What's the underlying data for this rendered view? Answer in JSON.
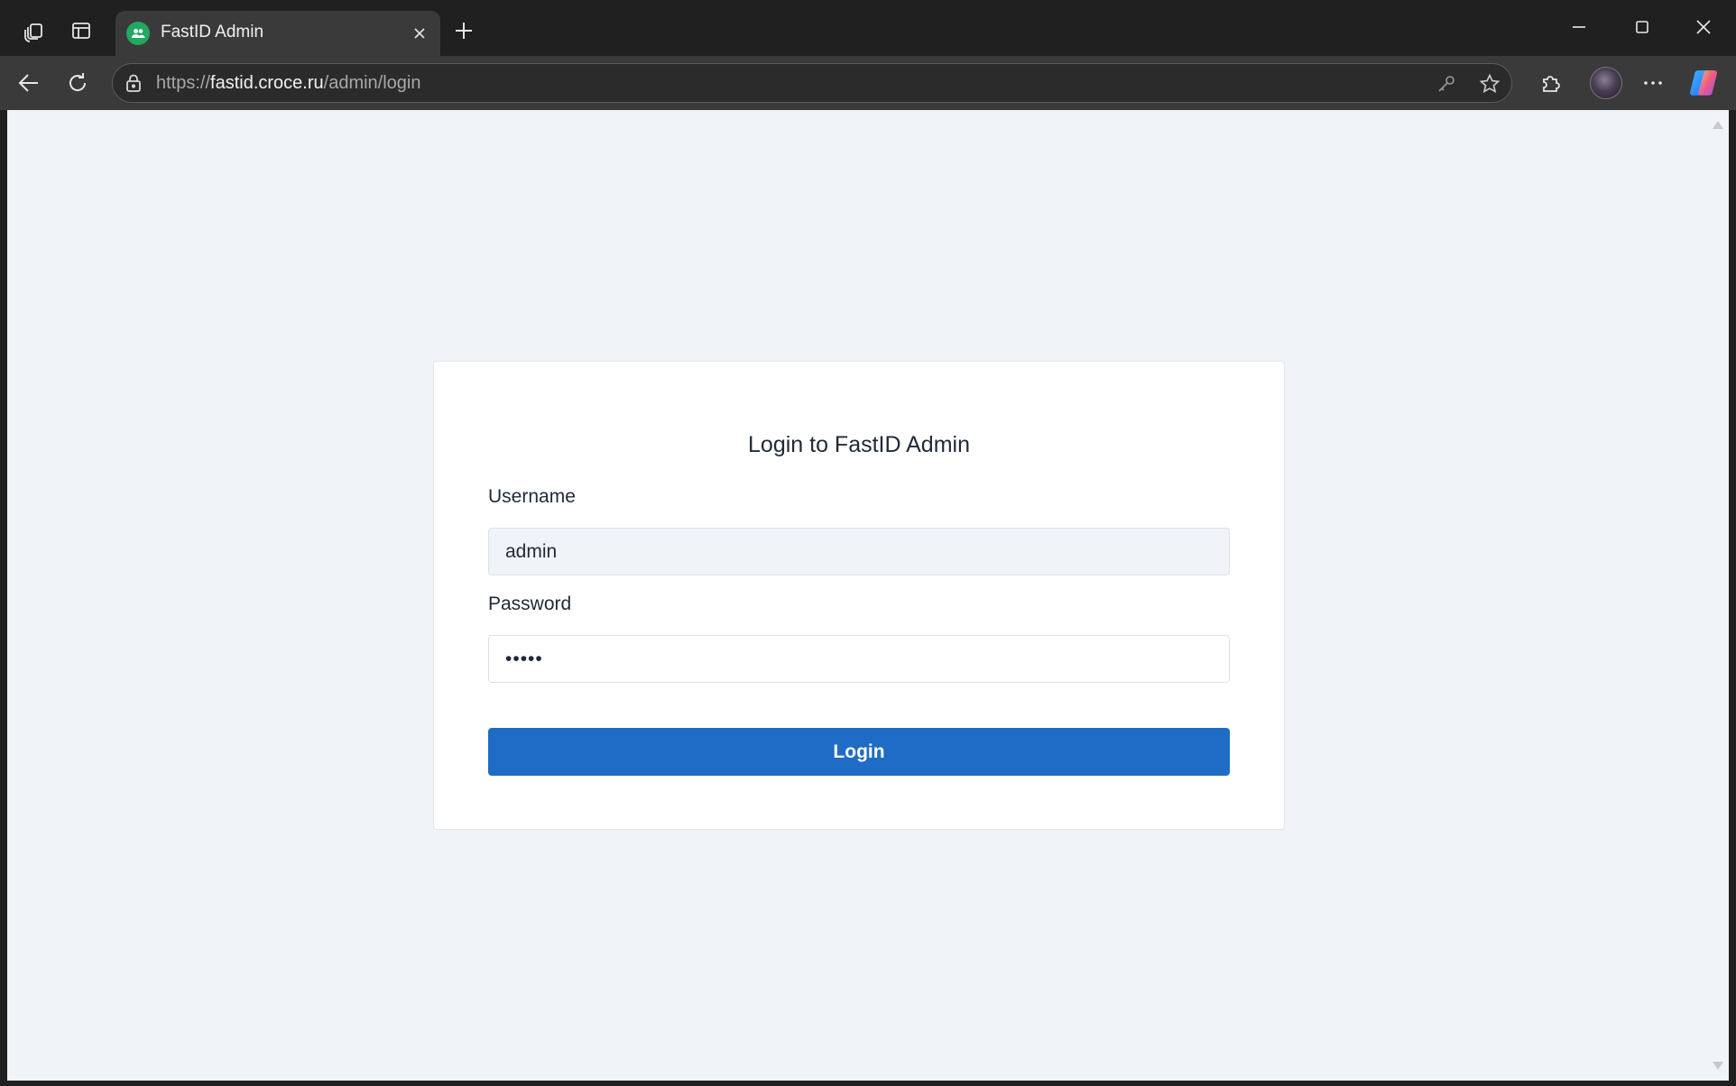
{
  "browser": {
    "tab": {
      "title": "FastID Admin"
    },
    "address": {
      "scheme": "https://",
      "host": "fastid.croce.ru",
      "path": "/admin/login"
    }
  },
  "page": {
    "title": "Login to FastID Admin",
    "username": {
      "label": "Username",
      "value": "admin"
    },
    "password": {
      "label": "Password",
      "masked_value": "•••••"
    },
    "login_button": "Login"
  },
  "colors": {
    "primary": "#1f6cc6",
    "page_background": "#f0f3f7",
    "card_background": "#ffffff",
    "favicon": "#22a861"
  }
}
